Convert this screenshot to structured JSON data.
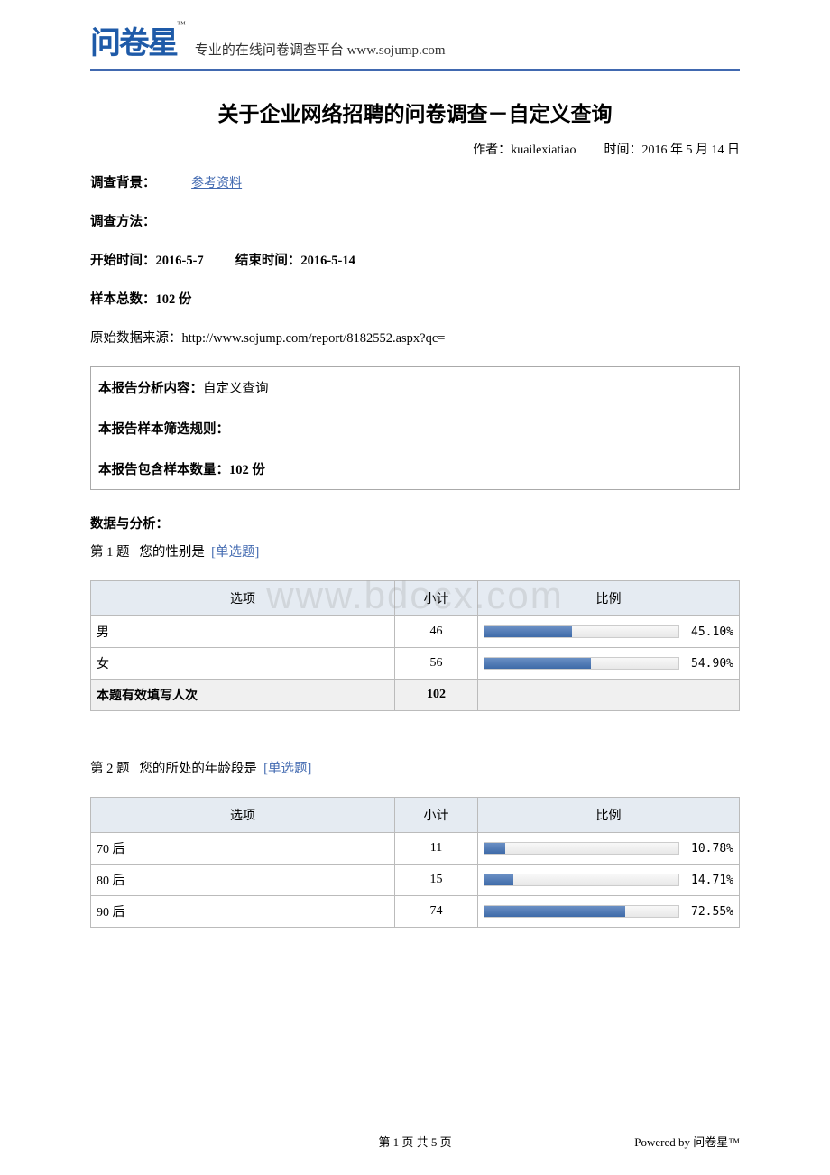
{
  "header": {
    "logo_text": "问卷星",
    "logo_tm": "™",
    "tagline": "专业的在线问卷调查平台 www.sojump.com"
  },
  "title": "关于企业网络招聘的问卷调查－自定义查询",
  "meta": {
    "author_label": "作者：",
    "author": "kuailexiatiao",
    "time_label": "时间：",
    "time": "2016 年 5 月 14 日"
  },
  "background": {
    "label": "调查背景：",
    "link": "参考资料"
  },
  "method": {
    "label": "调查方法："
  },
  "dates": {
    "start_label": "开始时间：",
    "start": "2016-5-7",
    "end_label": "结束时间：",
    "end": "2016-5-14"
  },
  "sample": {
    "label": "样本总数：",
    "value": "102  份"
  },
  "source": {
    "label": "原始数据来源：",
    "value": "http://www.sojump.com/report/8182552.aspx?qc="
  },
  "analysis": {
    "content_label": "本报告分析内容：",
    "content_value": "自定义查询",
    "filter_label": "本报告样本筛选规则：",
    "count_label": "本报告包含样本数量：",
    "count_value": "102 份"
  },
  "data_header": "数据与分析：",
  "table_headers": {
    "option": "选项",
    "subtotal": "小计",
    "ratio": "比例"
  },
  "total_row_label": "本题有效填写人次",
  "q1": {
    "prefix": "第 1 题",
    "text": "您的性别是",
    "tag": "[单选题]",
    "total": "102"
  },
  "q2": {
    "prefix": "第 2 题",
    "text": "您的所处的年龄段是",
    "tag": "[单选题]"
  },
  "chart_data": [
    {
      "type": "bar",
      "title": "第 1 题  您的性别是",
      "categories": [
        "男",
        "女"
      ],
      "values": [
        46,
        56
      ],
      "percentages": [
        45.1,
        54.9
      ],
      "total": 102
    },
    {
      "type": "bar",
      "title": "第 2 题  您的所处的年龄段是",
      "categories": [
        "70 后",
        "80 后",
        "90 后"
      ],
      "values": [
        11,
        15,
        74
      ],
      "percentages": [
        10.78,
        14.71,
        72.55
      ]
    }
  ],
  "watermark": "www.bdocx.com",
  "footer": {
    "page": "第 1 页 共 5 页",
    "powered": "Powered by 问卷星™"
  }
}
